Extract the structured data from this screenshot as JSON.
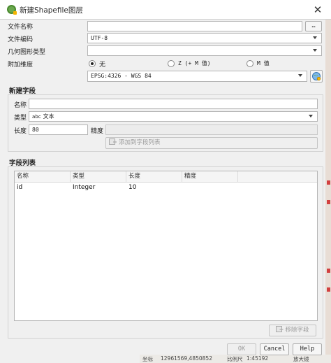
{
  "window": {
    "title": "新建Shapefile图层",
    "close_glyph": "✕"
  },
  "file_name": {
    "label": "文件名称",
    "value": "",
    "browse_label": "…"
  },
  "encoding": {
    "label": "文件编码",
    "value": "UTF-8"
  },
  "geometry_type": {
    "label": "几何图形类型",
    "value": ""
  },
  "dimensions": {
    "label": "附加维度",
    "options": [
      {
        "label": "无",
        "checked": true
      },
      {
        "label": "Z (+ M 值)",
        "checked": false
      },
      {
        "label": "M 值",
        "checked": false
      }
    ]
  },
  "crs": {
    "value": "EPSG:4326 - WGS 84",
    "icon": "globe-crs-icon"
  },
  "new_field": {
    "section_title": "新建字段",
    "name_label": "名称",
    "name_value": "",
    "type_label": "类型",
    "type_prefix": "abc",
    "type_value": "文本",
    "length_label": "长度",
    "length_value": "80",
    "precision_label": "精度",
    "precision_value": "",
    "add_button": "添加到字段列表",
    "add_icon": "add-field-icon"
  },
  "field_list": {
    "section_title": "字段列表",
    "columns": [
      "名称",
      "类型",
      "长度",
      "精度"
    ],
    "rows": [
      {
        "name": "id",
        "type": "Integer",
        "length": "10",
        "precision": ""
      }
    ],
    "remove_button": "移除字段",
    "remove_icon": "remove-field-icon"
  },
  "buttons": {
    "ok": "OK",
    "cancel": "Cancel",
    "help": "Help"
  },
  "background_status": {
    "coord_label": "坐标",
    "coord_value": "12961569,4850852",
    "scale_label": "比例尺",
    "scale_value": "1:45192",
    "magnifier": "放大镜",
    "accent": "#d24040"
  }
}
